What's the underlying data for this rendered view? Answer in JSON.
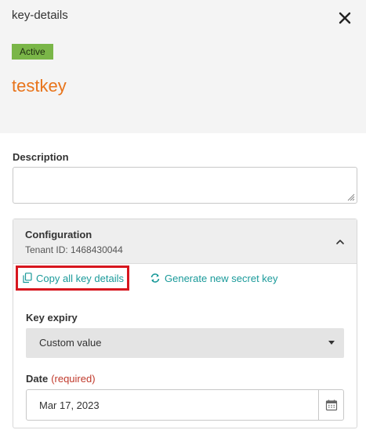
{
  "header": {
    "title": "key-details",
    "status_badge": "Active",
    "key_name": "testkey",
    "close_icon": "close-icon"
  },
  "description": {
    "label": "Description",
    "value": ""
  },
  "configuration": {
    "title": "Configuration",
    "tenant_id": "Tenant ID: 1468430044",
    "expanded": true,
    "actions": {
      "copy_label": "Copy all key details",
      "generate_label": "Generate new secret key"
    },
    "key_expiry": {
      "label": "Key expiry",
      "selected": "Custom value"
    },
    "date": {
      "label": "Date",
      "required_text": "(required)",
      "value": "Mar 17, 2023"
    }
  },
  "colors": {
    "accent": "#e8741b",
    "badge": "#7ab648",
    "link": "#1a9a9a",
    "highlight": "#d7161e",
    "required": "#c0392b"
  }
}
